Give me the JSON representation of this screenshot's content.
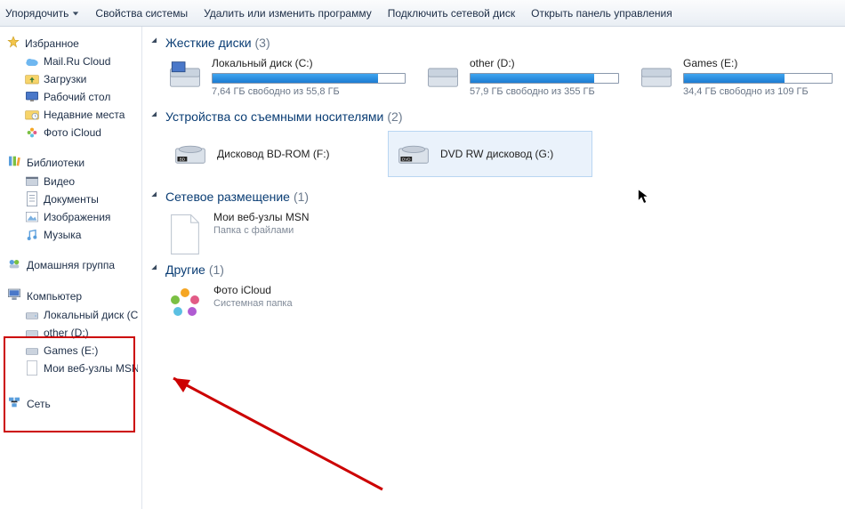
{
  "toolbar": {
    "organize": "Упорядочить",
    "items": [
      "Свойства системы",
      "Удалить или изменить программу",
      "Подключить сетевой диск",
      "Открыть панель управления"
    ]
  },
  "sidebar": {
    "favorites": {
      "label": "Избранное",
      "items": [
        {
          "icon": "cloud",
          "label": "Mail.Ru Cloud"
        },
        {
          "icon": "folder-dl",
          "label": "Загрузки"
        },
        {
          "icon": "desktop",
          "label": "Рабочий стол"
        },
        {
          "icon": "recent",
          "label": "Недавние места"
        },
        {
          "icon": "photo",
          "label": "Фото iCloud"
        }
      ]
    },
    "libraries": {
      "label": "Библиотеки",
      "items": [
        {
          "icon": "video",
          "label": "Видео"
        },
        {
          "icon": "doc",
          "label": "Документы"
        },
        {
          "icon": "image",
          "label": "Изображения"
        },
        {
          "icon": "music",
          "label": "Музыка"
        }
      ]
    },
    "homegroup": "Домашняя группа",
    "computer": {
      "label": "Компьютер",
      "items": [
        {
          "icon": "hdd",
          "label": "Локальный диск (C"
        },
        {
          "icon": "hdd-sm",
          "label": "other (D:)"
        },
        {
          "icon": "hdd-sm",
          "label": "Games (E:)"
        },
        {
          "icon": "page",
          "label": "Мои веб-узлы MSN"
        }
      ]
    },
    "network": "Сеть"
  },
  "content": {
    "hard_drives": {
      "label": "Жесткие диски",
      "count": "(3)",
      "drives": [
        {
          "name": "Локальный диск (C:)",
          "free": "7,64 ГБ свободно из 55,8 ГБ",
          "fill_pct": 86
        },
        {
          "name": "other (D:)",
          "free": "57,9 ГБ свободно из 355 ГБ",
          "fill_pct": 84
        },
        {
          "name": "Games (E:)",
          "free": "34,4 ГБ свободно из 109 ГБ",
          "fill_pct": 68
        }
      ]
    },
    "removable": {
      "label": "Устройства со съемными носителями",
      "count": "(2)",
      "devices": [
        {
          "name": "Дисковод BD-ROM (F:)",
          "kind": "bd"
        },
        {
          "name": "DVD RW дисковод (G:)",
          "kind": "dvd",
          "selected": true
        }
      ]
    },
    "network_loc": {
      "label": "Сетевое размещение",
      "count": "(1)",
      "item": {
        "name": "Мои веб-узлы MSN",
        "sub": "Папка с файлами"
      }
    },
    "other": {
      "label": "Другие",
      "count": "(1)",
      "item": {
        "name": "Фото iCloud",
        "sub": "Системная папка"
      }
    }
  }
}
